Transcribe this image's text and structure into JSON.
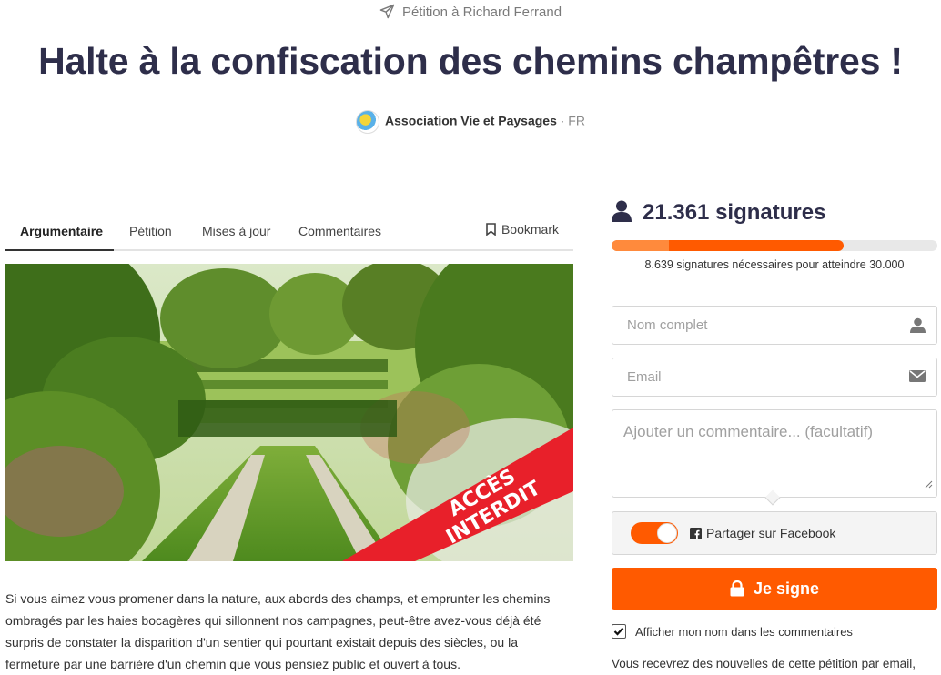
{
  "header": {
    "recipient": "Pétition à Richard Ferrand",
    "title": "Halte à la confiscation des chemins champêtres !",
    "author_name": "Association Vie et Paysages",
    "author_country": " · FR"
  },
  "tabs": {
    "items": [
      {
        "label": "Argumentaire"
      },
      {
        "label": "Pétition"
      },
      {
        "label": "Mises à jour"
      },
      {
        "label": "Commentaires"
      }
    ],
    "bookmark_label": "Bookmark"
  },
  "hero": {
    "banner_text": "ACCÈS INTERDIT"
  },
  "body": {
    "text": "Si vous aimez vous promener dans la nature, aux abords des champs, et emprunter les chemins ombragés par les haies bocagères qui sillonnent nos campagnes, peut-être avez-vous déjà été surpris de constater la disparition d'un sentier qui pourtant existait depuis des siècles, ou la fermeture par une barrière d'un chemin que vous pensiez public et ouvert à tous."
  },
  "signatures": {
    "count_label": "21.361 signatures",
    "count": 21361,
    "goal": 30000,
    "progress_fraction": 0.712,
    "needed_label": "8.639 signatures nécessaires pour atteindre 30.000"
  },
  "form": {
    "name_placeholder": "Nom complet",
    "email_placeholder": "Email",
    "comment_placeholder": "Ajouter un commentaire... (facultatif)",
    "facebook_label": "Partager sur Facebook",
    "facebook_toggle_on": true,
    "sign_label": "Je signe",
    "show_name_label": "Afficher mon nom dans les commentaires",
    "show_name_checked": true,
    "newsletter_text": "Vous recevrez des nouvelles de cette pétition par email,"
  },
  "colors": {
    "accent": "#ff5a00",
    "title": "#2e2e4a",
    "banner": "#e8202a"
  }
}
